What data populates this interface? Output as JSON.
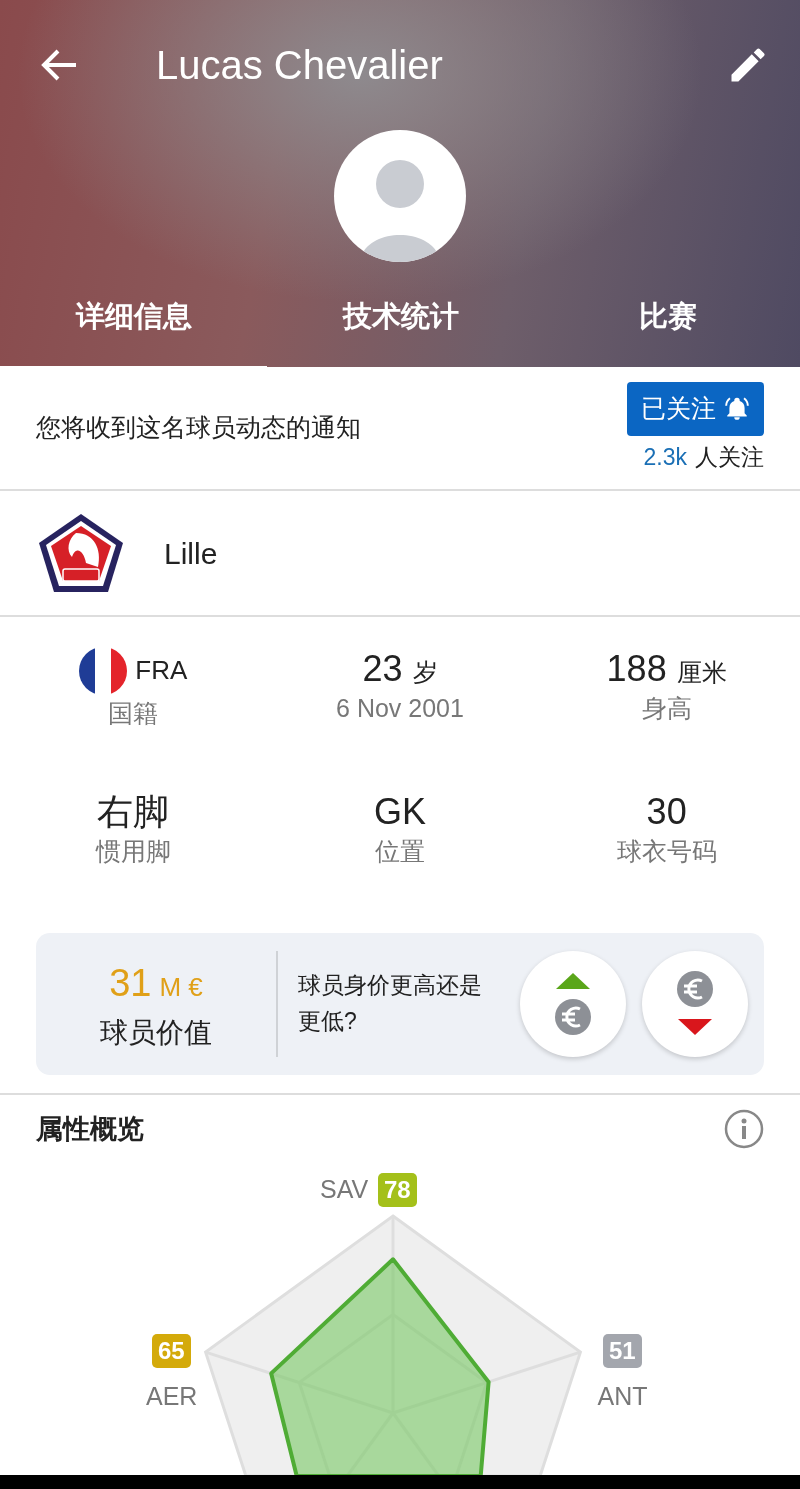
{
  "header": {
    "title": "Lucas Chevalier"
  },
  "tabs": [
    {
      "label": "详细信息",
      "selected": true
    },
    {
      "label": "技术统计",
      "selected": false
    },
    {
      "label": "比赛",
      "selected": false
    }
  ],
  "follow": {
    "message": "您将收到这名球员动态的通知",
    "button": "已关注",
    "following": true,
    "count": "2.3k",
    "count_label": "人关注"
  },
  "club": {
    "name": "Lille"
  },
  "facts": [
    {
      "value": "FRA",
      "caption": "国籍",
      "flag": true
    },
    {
      "value": "23",
      "unit": "岁",
      "caption": "6 Nov 2001"
    },
    {
      "value": "188",
      "unit": "厘米",
      "caption": "身高"
    },
    {
      "value": "右脚",
      "caption": "惯用脚"
    },
    {
      "value": "GK",
      "caption": "位置"
    },
    {
      "value": "30",
      "caption": "球衣号码"
    }
  ],
  "market_value": {
    "amount": "31",
    "unit": "M €",
    "caption": "球员价值",
    "question": "球员身价更高还是更低?"
  },
  "attributes": {
    "title": "属性概览",
    "items": [
      {
        "label": "SAV",
        "value": "78",
        "color": "#a4c01a"
      },
      {
        "label": "AER",
        "value": "65",
        "color": "#d4aa0a"
      },
      {
        "label": "ANT",
        "value": "51",
        "color": "#a3a6ad"
      }
    ]
  }
}
